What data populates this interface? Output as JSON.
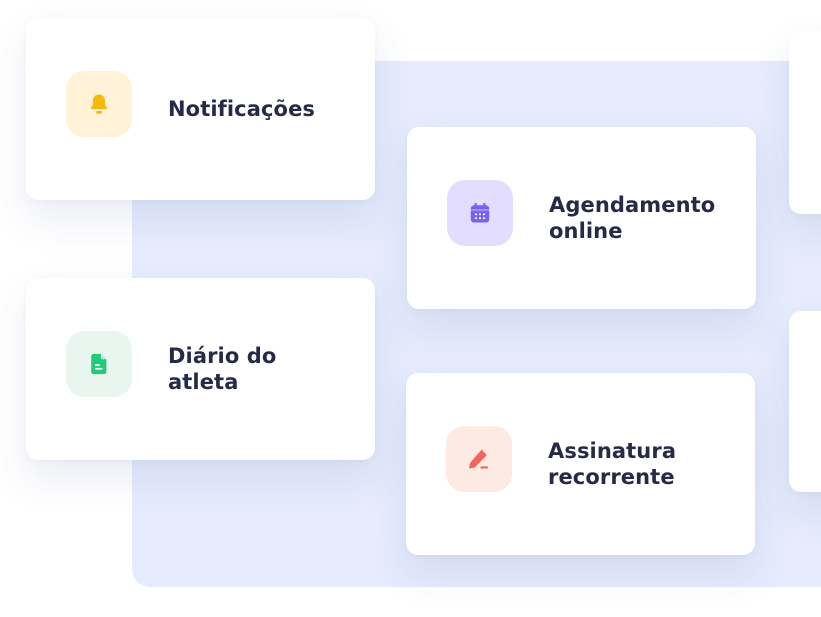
{
  "colors": {
    "panel_background": "#e6ecfd",
    "card_background": "#ffffff",
    "label_text": "#262a46"
  },
  "features": [
    {
      "label": "Notificações",
      "icon": "bell-icon",
      "icon_color": "#f5b80d",
      "tile_color": "#fff2d6"
    },
    {
      "label": "Agendamento\nonline",
      "icon": "calendar-icon",
      "icon_color": "#7a62f0",
      "tile_color": "#e3ddff"
    },
    {
      "label": "Diário do\natleta",
      "icon": "document-icon",
      "icon_color": "#25c97e",
      "tile_color": "#e9f6f0"
    },
    {
      "label": "Assinatura\nrecorrente",
      "icon": "pen-icon",
      "icon_color": "#f3655c",
      "tile_color": "#fdebe3"
    }
  ]
}
